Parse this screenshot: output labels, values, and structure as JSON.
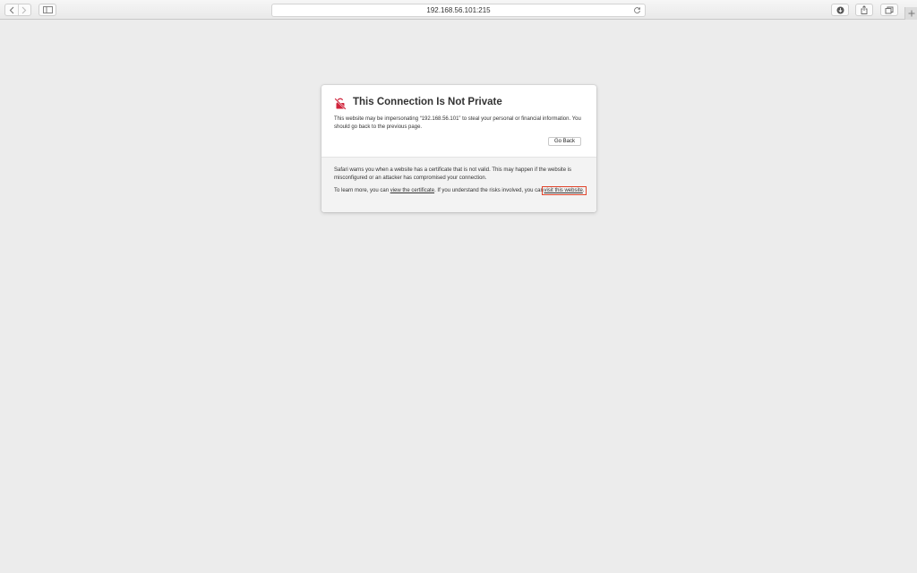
{
  "browser": {
    "url": "192.168.56.101:215",
    "icons": {
      "back": "chevron-left-icon",
      "forward": "chevron-right-icon",
      "sidebar": "sidebar-icon",
      "reload": "reload-icon",
      "downloads": "download-icon",
      "share": "share-icon",
      "tabs": "tabs-overview-icon",
      "new_tab": "plus-icon"
    }
  },
  "warning": {
    "title": "This Connection Is Not Private",
    "description": "This website may be impersonating “192.168.56.101” to steal your personal or financial information. You should go back to the previous page.",
    "go_back_label": "Go Back",
    "info": "Safari warns you when a website has a certificate that is not valid. This may happen if the website is misconfigured or an attacker has compromised your connection.",
    "learn_prefix": "To learn more, you can ",
    "view_certificate_link": "view the certificate",
    "learn_middle": ". If you understand the risks involved, you can ",
    "visit_website_link": "visit this website",
    "learn_suffix": ".",
    "icon": "broken-lock-icon",
    "icon_color": "#d0243c",
    "highlight_color": "#e0442b"
  }
}
